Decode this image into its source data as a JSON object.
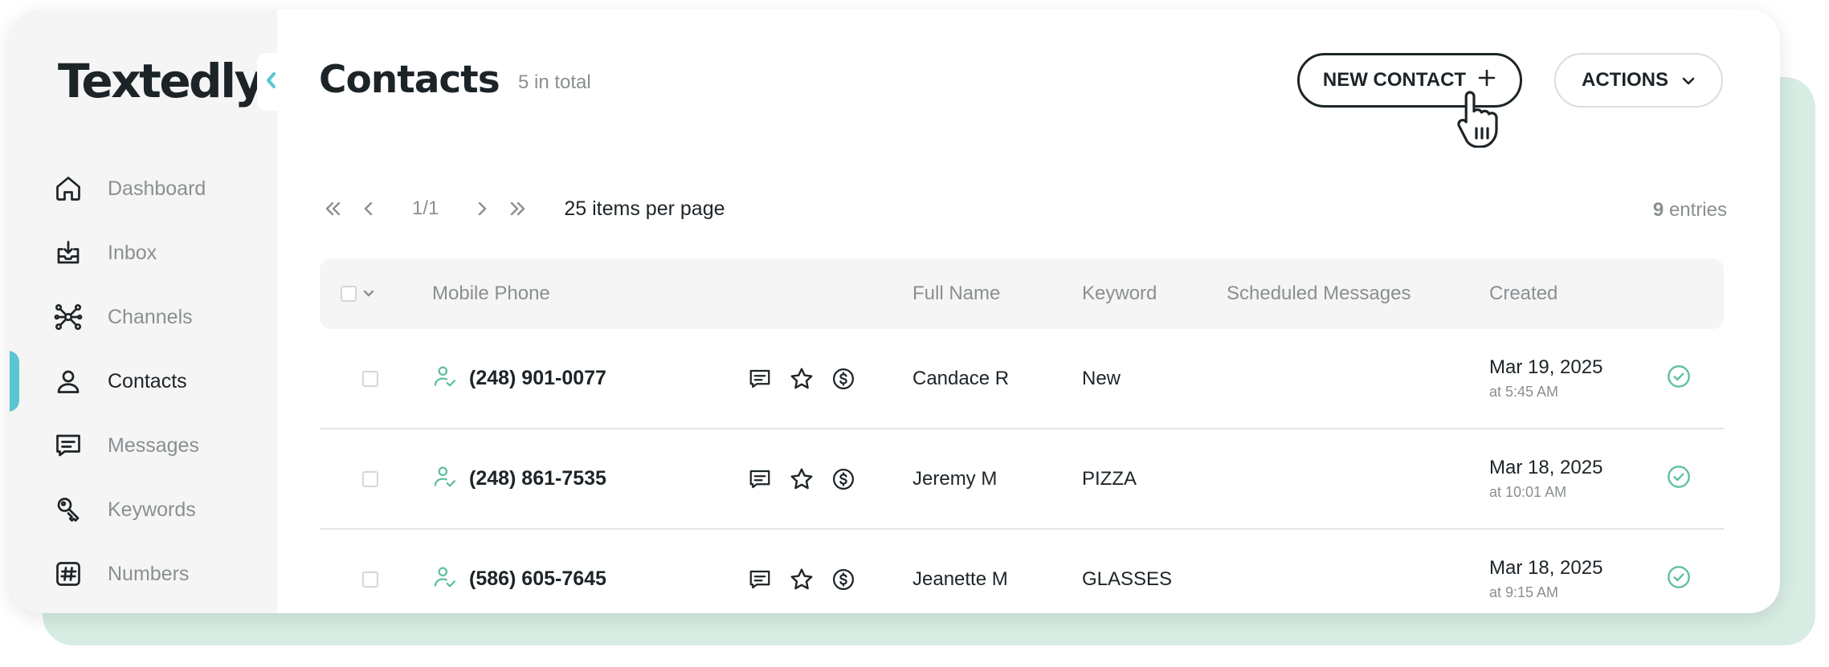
{
  "brand": {
    "logo_text": "Textedly",
    "accent_color": "#5bc6d2",
    "shadow_color": "#d7ece3",
    "dark_color": "#1d2428"
  },
  "sidebar": {
    "collapse_icon": "chevron-left-icon",
    "items": [
      {
        "label": "Dashboard",
        "icon": "home-icon",
        "active": false
      },
      {
        "label": "Inbox",
        "icon": "inbox-icon",
        "active": false
      },
      {
        "label": "Channels",
        "icon": "channels-icon",
        "active": false
      },
      {
        "label": "Contacts",
        "icon": "user-icon",
        "active": true
      },
      {
        "label": "Messages",
        "icon": "message-icon",
        "active": false
      },
      {
        "label": "Keywords",
        "icon": "key-icon",
        "active": false
      },
      {
        "label": "Numbers",
        "icon": "hash-icon",
        "active": false
      }
    ]
  },
  "header": {
    "title": "Contacts",
    "total": "5 in total",
    "new_contact_label": "NEW CONTACT",
    "actions_label": "ACTIONS"
  },
  "pagination": {
    "page_text": "1/1",
    "per_page_text": "25 items per page",
    "entries_count": "9",
    "entries_label": "entries"
  },
  "table": {
    "columns": {
      "mobile_phone": "Mobile Phone",
      "full_name": "Full Name",
      "keyword": "Keyword",
      "scheduled": "Scheduled Messages",
      "created": "Created"
    },
    "rows": [
      {
        "phone": "(248) 901-0077",
        "name": "Candace R",
        "keyword": "New",
        "scheduled": "",
        "created_date": "Mar 19, 2025",
        "created_time": "at 5:45 AM"
      },
      {
        "phone": "(248) 861-7535",
        "name": "Jeremy M",
        "keyword": "PIZZA",
        "scheduled": "",
        "created_date": "Mar 18, 2025",
        "created_time": "at 10:01 AM"
      },
      {
        "phone": "(586) 605-7645",
        "name": "Jeanette M",
        "keyword": "GLASSES",
        "scheduled": "",
        "created_date": "Mar 18, 2025",
        "created_time": "at 9:15 AM"
      }
    ]
  }
}
